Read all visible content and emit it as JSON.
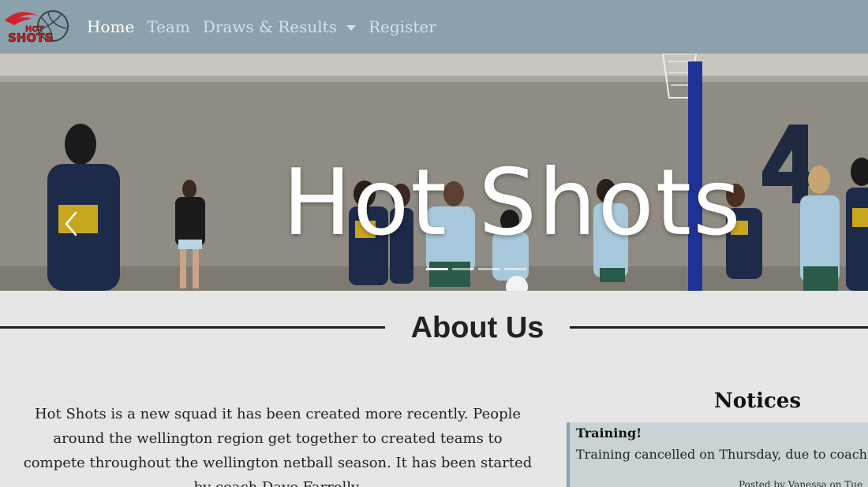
{
  "navbar": {
    "logo_text": "HOT SHOTS",
    "links": [
      {
        "label": "Home",
        "active": true
      },
      {
        "label": "Team",
        "active": false
      },
      {
        "label": "Draws & Results",
        "active": false,
        "dropdown": true
      },
      {
        "label": "Register",
        "active": false
      }
    ],
    "bg_color": "#8ba1ab"
  },
  "hero": {
    "title": "Hot Shots",
    "indicators_count": 4,
    "active_indicator": 0,
    "prev_icon": "chevron-left-icon"
  },
  "about": {
    "heading": "About Us",
    "text": "Hot Shots is a new squad it has been created more recently. People around the wellington region get together to created teams to compete throughout the wellington netball season. It has been started by coach Dave Farrelly."
  },
  "notices": {
    "heading": "Notices",
    "items": [
      {
        "title": "Training!",
        "body": "Training cancelled on Thursday, due to coach being s",
        "footer": "Posted by Vanessa on Tue"
      }
    ]
  }
}
